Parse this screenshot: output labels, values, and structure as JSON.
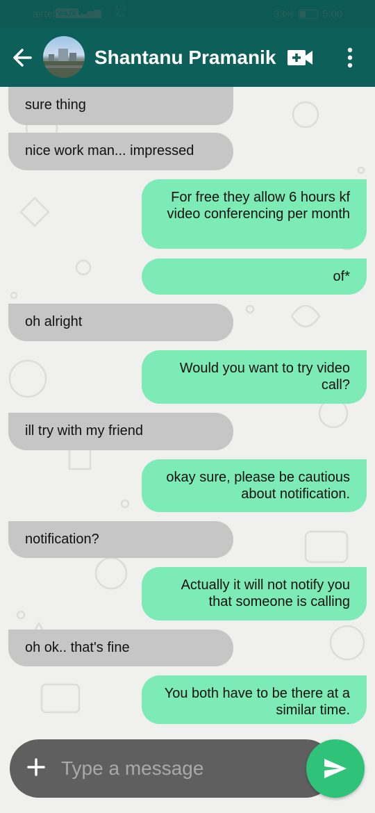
{
  "status_bar": {
    "carrier": "airtel",
    "volte": "VoLTE",
    "net_speed_value": "127",
    "net_speed_unit": "K/s",
    "battery": "33%",
    "time": "5:00"
  },
  "header": {
    "contact_name": "Shantanu Pramanik",
    "back_icon": "arrow-left-icon",
    "video_icon": "video-call-icon",
    "menu_icon": "more-vertical-icon"
  },
  "messages": [
    {
      "direction": "incoming",
      "text": "sure thing"
    },
    {
      "direction": "incoming",
      "text": "nice work man... impressed"
    },
    {
      "direction": "outgoing",
      "text": "For free they allow 6 hours kf video conferencing per month"
    },
    {
      "direction": "outgoing",
      "text": "of*"
    },
    {
      "direction": "incoming",
      "text": "oh alright"
    },
    {
      "direction": "outgoing",
      "text": "Would you want to try video call?"
    },
    {
      "direction": "incoming",
      "text": "ill try with my friend"
    },
    {
      "direction": "outgoing",
      "text": "okay sure, please be cautious about notification."
    },
    {
      "direction": "incoming",
      "text": "notification?"
    },
    {
      "direction": "outgoing",
      "text": "Actually it will not notify you that someone is calling"
    },
    {
      "direction": "incoming",
      "text": "oh ok.. that's fine"
    },
    {
      "direction": "outgoing",
      "text": "You both have to be there at a similar time."
    }
  ],
  "composer": {
    "placeholder": "Type a message",
    "attach_icon": "plus-icon",
    "send_icon": "send-icon"
  },
  "colors": {
    "app_bar": "#0d5f59",
    "incoming_bubble": "#c6c6c6",
    "outgoing_bubble": "#7cebb5",
    "send_button": "#2fc37a"
  }
}
